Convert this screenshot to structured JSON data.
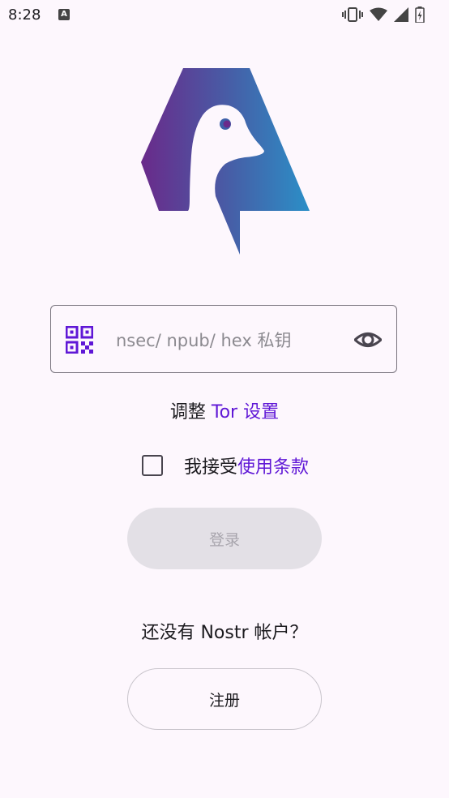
{
  "status_bar": {
    "time": "8:28",
    "notification_icon": "app-notification-icon",
    "icons": [
      "vibrate-icon",
      "wifi-icon",
      "cellular-signal-icon",
      "battery-icon"
    ]
  },
  "login": {
    "key_input": {
      "value": "",
      "placeholder": "nsec/ npub/ hex 私钥"
    },
    "tor_prefix": "调整 ",
    "tor_link": "Tor 设置",
    "terms_prefix": "我接受",
    "terms_link": "使用条款",
    "terms_checked": false,
    "login_button": "登录",
    "no_account_text": "还没有 Nostr 帐户？",
    "signup_button": "注册"
  },
  "colors": {
    "accent": "#5f17d6",
    "background": "#fdf7fd",
    "logo_gradient_start": "#6a2a8a",
    "logo_gradient_end": "#2b8fc7"
  }
}
